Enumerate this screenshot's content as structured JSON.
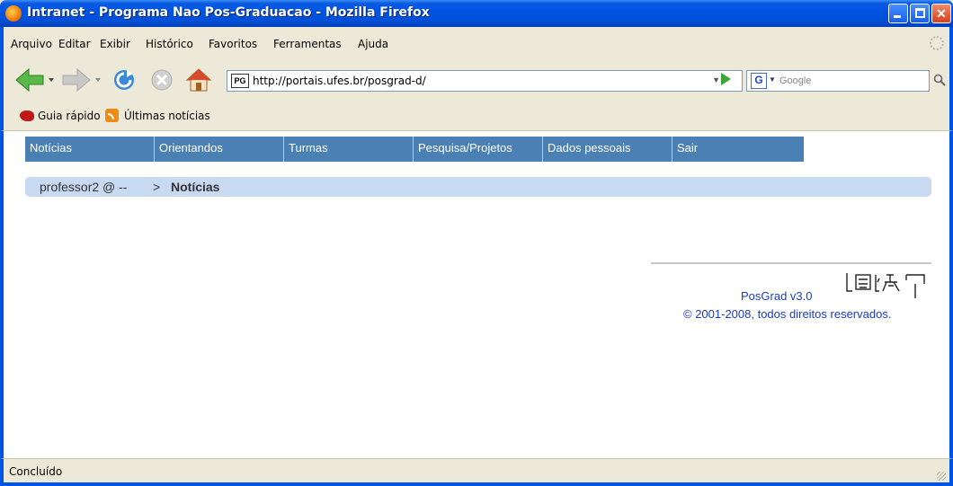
{
  "window": {
    "title": "Intranet - Programa Nao Pos-Graduacao - Mozilla Firefox",
    "close_glyph": "✕"
  },
  "menu": {
    "items": [
      "Arquivo",
      "Editar",
      "Exibir",
      "Histórico",
      "Favoritos",
      "Ferramentas",
      "Ajuda"
    ]
  },
  "toolbar": {
    "url": "http://portais.ufes.br/posgrad-d/",
    "site_icon_text": "PG",
    "url_dropdown": "▼",
    "search_engine": "G",
    "search_dropdown": "▼",
    "search_placeholder": "Google"
  },
  "bookmarks": {
    "items": [
      "Guia rápido",
      "Últimas notícias"
    ]
  },
  "page": {
    "tabs": [
      "Notícias",
      "Orientandos",
      "Turmas",
      "Pesquisa/Projetos",
      "Dados pessoais",
      "Sair"
    ],
    "breadcrumb": {
      "user": "professor2 @ --",
      "separator": ">",
      "current": "Notícias"
    },
    "footer": {
      "version": "PosGrad v3.0",
      "copyright": "© 2001-2008, todos direitos reservados."
    }
  },
  "status": {
    "text": "Concluído"
  },
  "colors": {
    "titlebar": "#0054e3",
    "tab_bg": "#4a80b4",
    "breadcrumb_bg": "#c8d9f2",
    "link": "#1a3cc8"
  }
}
